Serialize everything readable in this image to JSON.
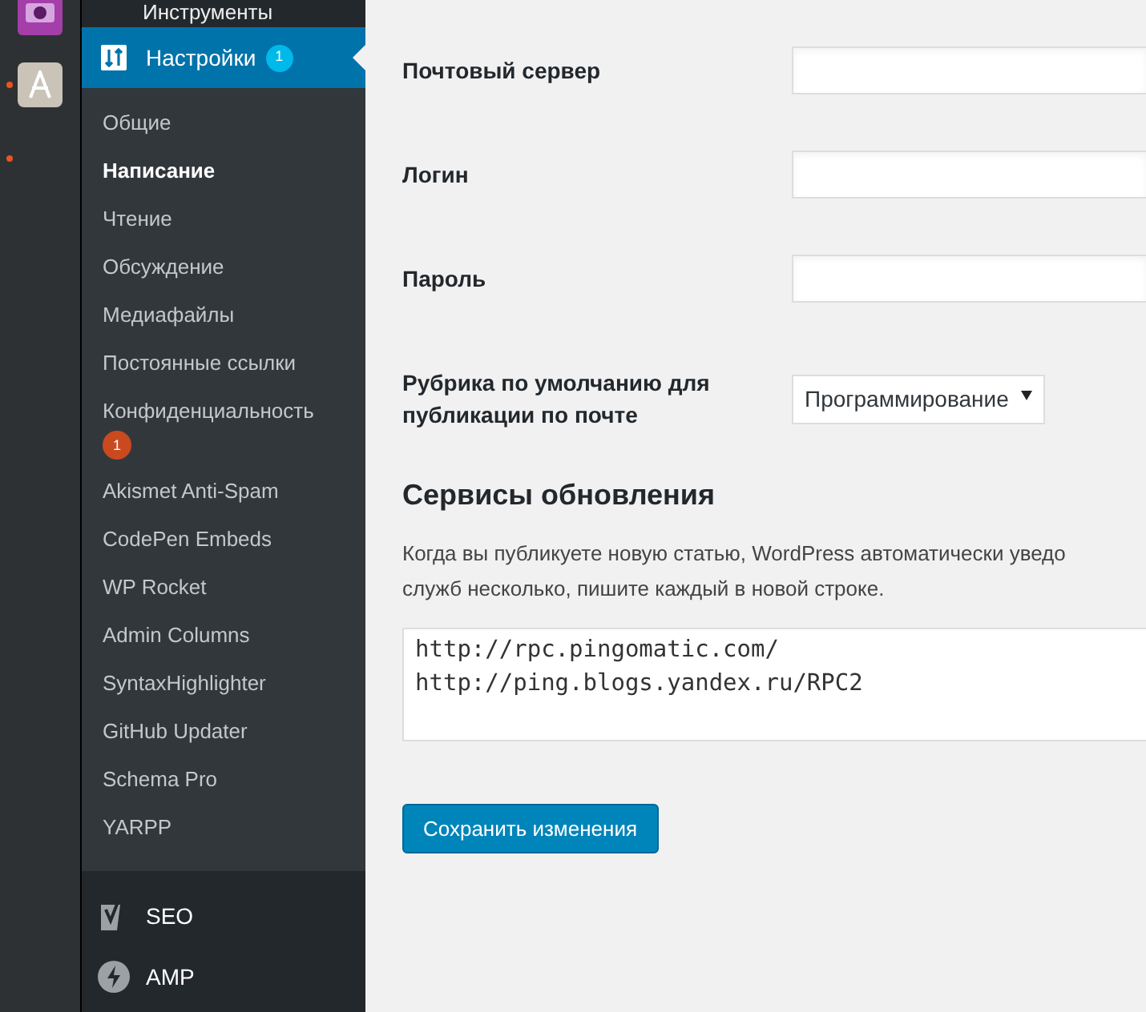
{
  "dock": [
    {
      "kind": "video",
      "running": false
    },
    {
      "kind": "store",
      "running": true
    },
    {
      "kind": "blank",
      "running": true
    }
  ],
  "menu": {
    "above": {
      "label": "Инструменты"
    },
    "current": {
      "label": "Настройки",
      "badge": "1"
    },
    "submenu": [
      {
        "label": "Общие",
        "selected": false
      },
      {
        "label": "Написание",
        "selected": true
      },
      {
        "label": "Чтение",
        "selected": false
      },
      {
        "label": "Обсуждение",
        "selected": false
      },
      {
        "label": "Медиафайлы",
        "selected": false
      },
      {
        "label": "Постоянные ссылки",
        "selected": false
      },
      {
        "label": "Конфиденциальность",
        "selected": false,
        "badge": "1"
      },
      {
        "label": "Akismet Anti-Spam",
        "selected": false
      },
      {
        "label": "CodePen Embeds",
        "selected": false
      },
      {
        "label": "WP Rocket",
        "selected": false
      },
      {
        "label": "Admin Columns",
        "selected": false
      },
      {
        "label": "SyntaxHighlighter",
        "selected": false
      },
      {
        "label": "GitHub Updater",
        "selected": false
      },
      {
        "label": "Schema Pro",
        "selected": false
      },
      {
        "label": "YARPP",
        "selected": false
      }
    ],
    "below": [
      {
        "label": "SEO",
        "kind": "yoast"
      },
      {
        "label": "AMP",
        "kind": "bolt"
      }
    ]
  },
  "form": [
    {
      "label": "Почтовый сервер",
      "kind": "text"
    },
    {
      "label": "Логин",
      "kind": "text"
    },
    {
      "label": "Пароль",
      "kind": "text"
    },
    {
      "label": "Рубрика по умолчанию для публикации по почте",
      "kind": "select",
      "value": "Программирование"
    }
  ],
  "update_services": {
    "heading": "Сервисы обновления",
    "description": [
      "Когда вы публикуете новую статью, WordPress автоматически уведо",
      "служб несколько, пишите каждый в новой строке."
    ],
    "value": "http://rpc.pingomatic.com/\nhttp://ping.blogs.yandex.ru/RPC2"
  },
  "save_button": "Сохранить изменения"
}
